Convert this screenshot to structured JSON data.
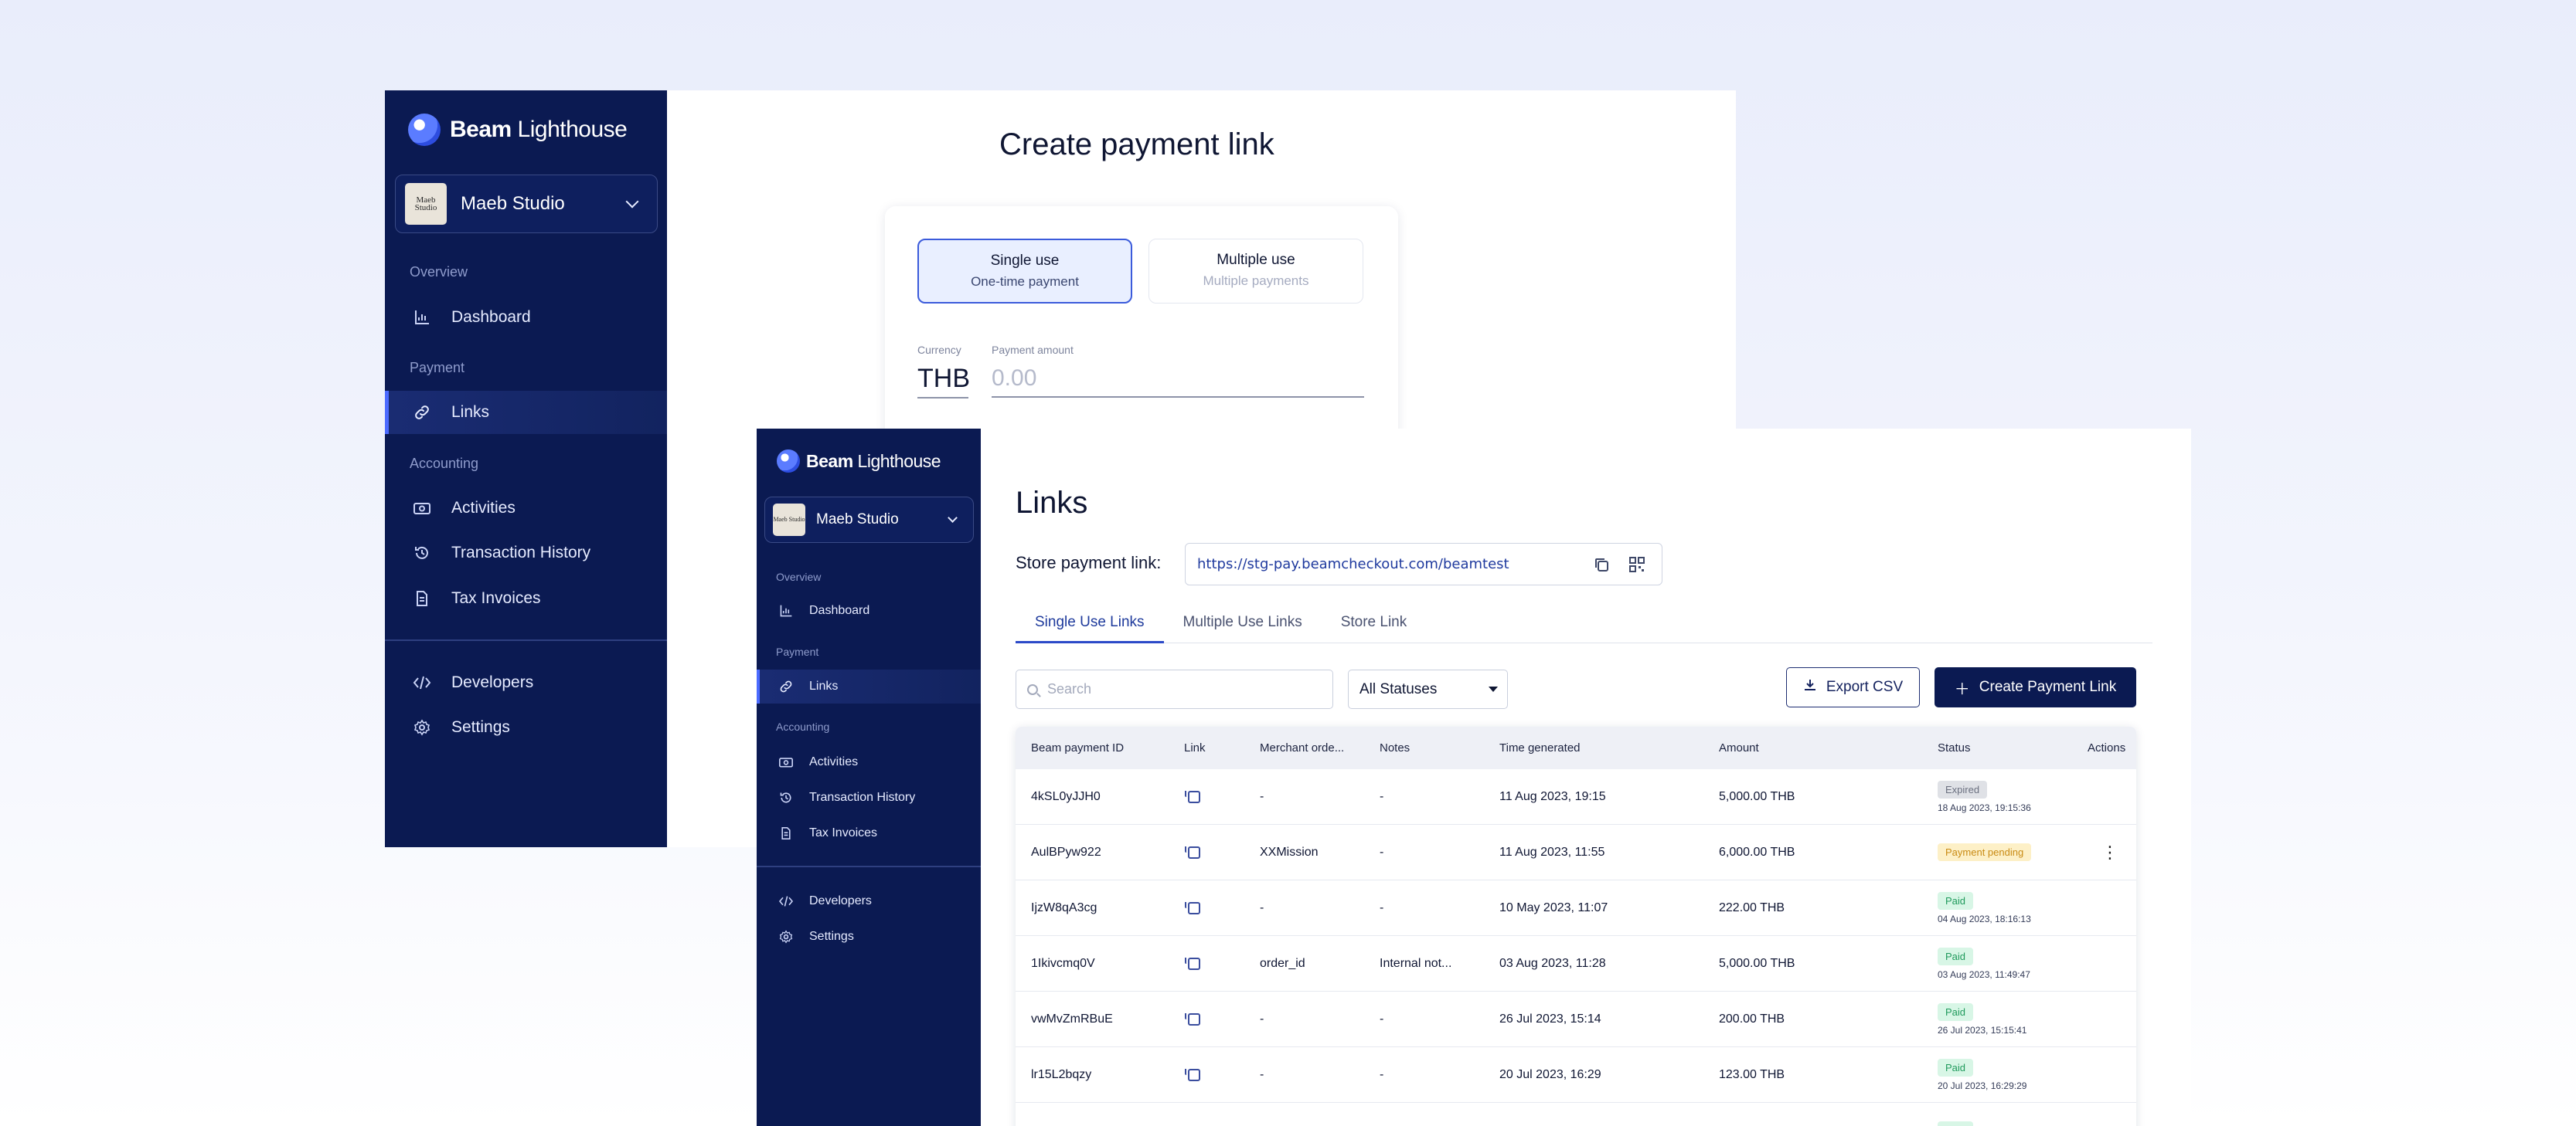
{
  "brand": {
    "name_bold": "Beam",
    "name_light": " Lighthouse"
  },
  "org": {
    "name": "Maeb Studio",
    "avatar_text": "Maeb Studio"
  },
  "sidebar": {
    "overview_label": "Overview",
    "payment_label": "Payment",
    "accounting_label": "Accounting",
    "items": {
      "dashboard": "Dashboard",
      "links": "Links",
      "activities": "Activities",
      "transaction_history": "Transaction History",
      "tax_invoices": "Tax Invoices",
      "developers": "Developers",
      "settings": "Settings"
    }
  },
  "create_form": {
    "title": "Create payment link",
    "single_title": "Single use",
    "single_sub": "One-time payment",
    "multi_title": "Multiple use",
    "multi_sub": "Multiple payments",
    "currency_label": "Currency",
    "amount_label": "Payment amount",
    "currency_value": "THB",
    "amount_placeholder": "0.00"
  },
  "links_page": {
    "title": "Links",
    "store_label": "Store payment link:",
    "store_url": "https://stg-pay.beamcheckout.com/beamtest",
    "tabs": [
      "Single Use Links",
      "Multiple Use Links",
      "Store Link"
    ],
    "search_placeholder": "Search",
    "status_filter": "All Statuses",
    "export_label": "Export CSV",
    "create_label": "Create Payment Link"
  },
  "table": {
    "columns": [
      "Beam payment ID",
      "Link",
      "Merchant orde...",
      "Notes",
      "Time generated",
      "Amount",
      "Status",
      "Actions"
    ],
    "rows": [
      {
        "id": "4kSL0yJJH0",
        "merchant": "-",
        "notes": "-",
        "time": "11 Aug 2023, 19:15",
        "amount": "5,000.00 THB",
        "status": "Expired",
        "status_time": "18 Aug 2023, 19:15:36",
        "kind": "expired",
        "actions": ""
      },
      {
        "id": "AulBPyw922",
        "merchant": "XXMission",
        "notes": "-",
        "time": "11 Aug 2023, 11:55",
        "amount": "6,000.00 THB",
        "status": "Payment pending",
        "status_time": "",
        "kind": "pending",
        "actions": "⋮"
      },
      {
        "id": "IjzW8qA3cg",
        "merchant": "-",
        "notes": "-",
        "time": "10 May 2023, 11:07",
        "amount": "222.00 THB",
        "status": "Paid",
        "status_time": "04 Aug 2023, 18:16:13",
        "kind": "paid",
        "actions": ""
      },
      {
        "id": "1Ikivcmq0V",
        "merchant": "order_id",
        "notes": "Internal not...",
        "time": "03 Aug 2023, 11:28",
        "amount": "5,000.00 THB",
        "status": "Paid",
        "status_time": "03 Aug 2023, 11:49:47",
        "kind": "paid",
        "actions": ""
      },
      {
        "id": "vwMvZmRBuE",
        "merchant": "-",
        "notes": "-",
        "time": "26 Jul 2023, 15:14",
        "amount": "200.00 THB",
        "status": "Paid",
        "status_time": "26 Jul 2023, 15:15:41",
        "kind": "paid",
        "actions": ""
      },
      {
        "id": "lr15L2bqzy",
        "merchant": "-",
        "notes": "-",
        "time": "20 Jul 2023, 16:29",
        "amount": "123.00 THB",
        "status": "Paid",
        "status_time": "20 Jul 2023, 16:29:29",
        "kind": "paid",
        "actions": ""
      },
      {
        "id": "",
        "merchant": "",
        "notes": "",
        "time": "",
        "amount": "",
        "status": "Paid",
        "status_time": "",
        "kind": "paid",
        "actions": ""
      }
    ]
  },
  "colors": {
    "sidebar_bg": "#0b1a52",
    "accent": "#2c4ac8",
    "paid": "#1f9a5c",
    "pending": "#c98b14",
    "expired": "#6b7080"
  }
}
